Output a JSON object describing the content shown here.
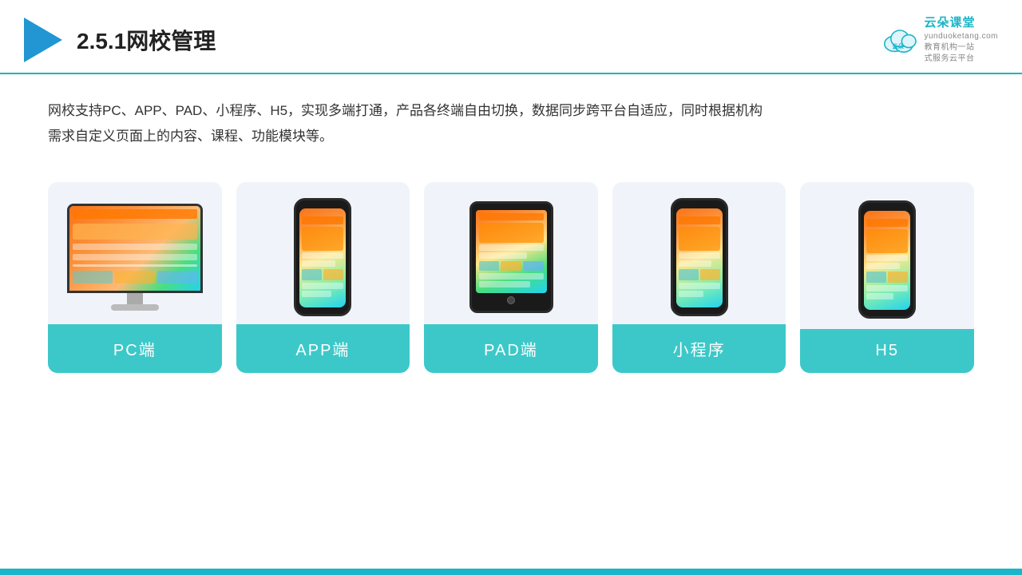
{
  "header": {
    "title": "2.5.1网校管理",
    "logo_brand": "云朵课堂",
    "logo_url": "yunduoketang.com",
    "logo_tagline_line1": "教育机构一站",
    "logo_tagline_line2": "式服务云平台"
  },
  "description": {
    "text": "网校支持PC、APP、PAD、小程序、H5，实现多端打通，产品各终端自由切换，数据同步跨平台自适应，同时根据机构需求自定义页面上的内容、课程、功能模块等。"
  },
  "cards": [
    {
      "id": "pc",
      "label": "PC端"
    },
    {
      "id": "app",
      "label": "APP端"
    },
    {
      "id": "pad",
      "label": "PAD端"
    },
    {
      "id": "miniprogram",
      "label": "小程序"
    },
    {
      "id": "h5",
      "label": "H5"
    }
  ]
}
